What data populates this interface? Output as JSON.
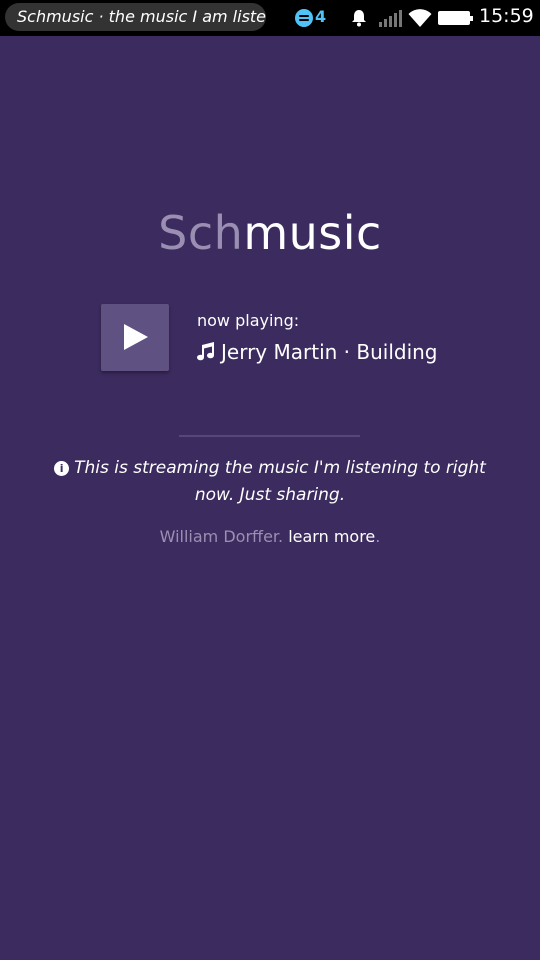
{
  "status_bar": {
    "window_title": "Schmusic · the music I am listening to",
    "notification_count": "4",
    "time": "15:59",
    "battery_level": 0.9,
    "accent": "#4fc3f7"
  },
  "logo": {
    "part1": "Sch",
    "part2": "music"
  },
  "player": {
    "now_playing_label": "now playing:",
    "track": "Jerry Martin · Building",
    "play_icon": "play-icon",
    "music_icon": "music-note-icon"
  },
  "info": {
    "icon": "i",
    "text": "This is streaming the music I'm listening to right now. Just sharing."
  },
  "credit": {
    "author": "William Dorffer.",
    "link_text": "learn more",
    "trailing": "."
  },
  "colors": {
    "background": "#3c2b5e",
    "button": "#5f5181",
    "muted": "#9a8fb3"
  }
}
